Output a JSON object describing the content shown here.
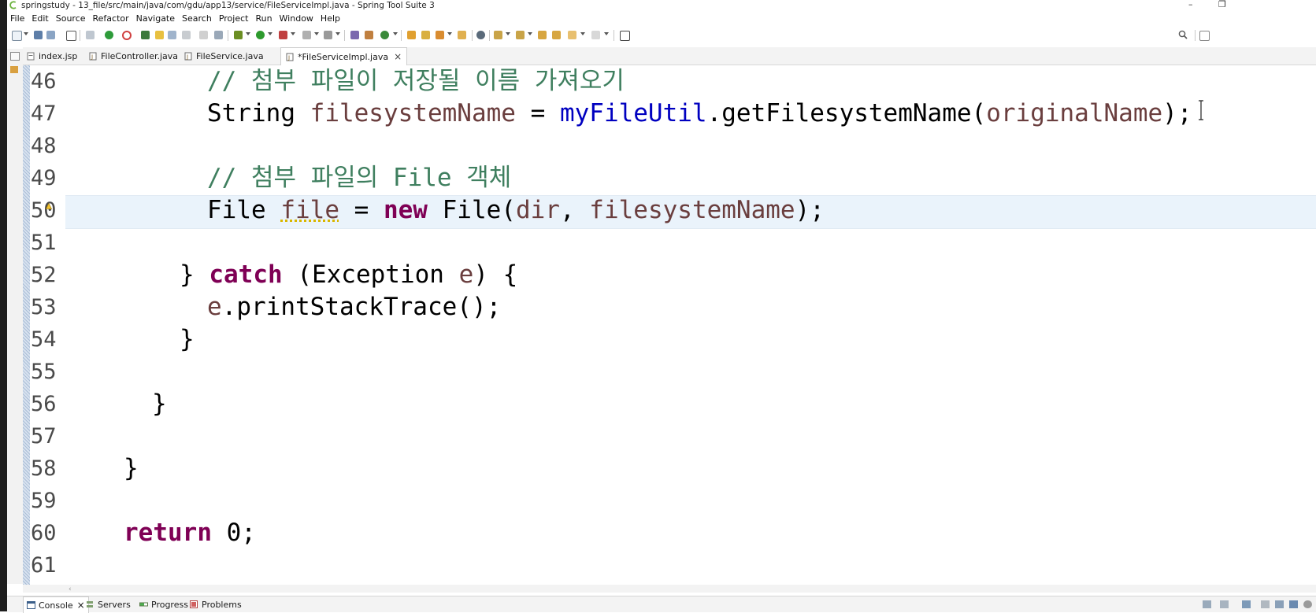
{
  "window": {
    "title": "springstudy - 13_file/src/main/java/com/gdu/app13/service/FileServiceImpl.java - Spring Tool Suite 3",
    "minimize_glyph": "–",
    "restore_glyph": "❐"
  },
  "menu": [
    "File",
    "Edit",
    "Source",
    "Refactor",
    "Navigate",
    "Search",
    "Project",
    "Run",
    "Window",
    "Help"
  ],
  "tabs": [
    {
      "label": "index.jsp",
      "icon": "jsp-file-icon"
    },
    {
      "label": "FileController.java",
      "icon": "java-file-icon"
    },
    {
      "label": "FileService.java",
      "icon": "java-file-icon"
    },
    {
      "label": "*FileServiceImpl.java",
      "icon": "java-file-icon",
      "active": true,
      "close": "×"
    }
  ],
  "editor": {
    "lines": [
      {
        "no": "46",
        "code": "// 첨부 파일이 저장될 이름 가져오기"
      },
      {
        "no": "47",
        "code_parts": [
          "String ",
          "filesystemName",
          " = ",
          "myFileUtil",
          ".getFilesystemName(",
          "originalName",
          ");"
        ]
      },
      {
        "no": "48"
      },
      {
        "no": "49",
        "code": "// 첨부 파일의 File 객체"
      },
      {
        "no": "50",
        "code_parts": [
          "File ",
          "file",
          " = ",
          "new",
          " File(",
          "dir",
          ", ",
          "filesystemName",
          ");"
        ]
      },
      {
        "no": "51"
      },
      {
        "no": "52",
        "code_parts": [
          "} ",
          "catch",
          " (Exception ",
          "e",
          ") {"
        ]
      },
      {
        "no": "53",
        "code_parts": [
          "e",
          ".printStackTrace();"
        ]
      },
      {
        "no": "54",
        "code": "}"
      },
      {
        "no": "55"
      },
      {
        "no": "56",
        "code": "}"
      },
      {
        "no": "57"
      },
      {
        "no": "58",
        "code": "}"
      },
      {
        "no": "59"
      },
      {
        "no": "60",
        "code_parts": [
          "return",
          " 0;"
        ]
      },
      {
        "no": "61"
      }
    ]
  },
  "bottom_tabs": [
    {
      "label": "Console",
      "icon": "console-icon",
      "active": true,
      "close": "×"
    },
    {
      "label": "Servers",
      "icon": "servers-icon"
    },
    {
      "label": "Progress",
      "icon": "progress-icon"
    },
    {
      "label": "Problems",
      "icon": "problems-icon"
    }
  ],
  "colors": {
    "comment": "#3f7f5f",
    "keyword": "#7f0055",
    "field": "#0000c0",
    "local_variable": "#6a3e3e",
    "current_line": "#eaf3fb"
  }
}
